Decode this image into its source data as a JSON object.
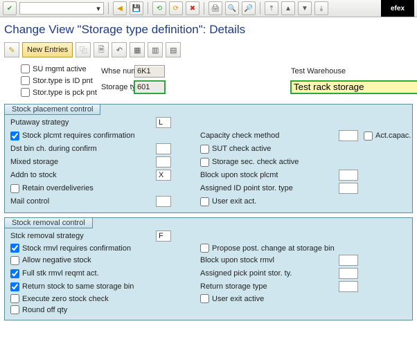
{
  "brand": "efex",
  "title": "Change View \"Storage type definition\": Details",
  "toolbar": {
    "combo_value": "",
    "new_entries": "New Entries"
  },
  "header": {
    "whse_label": "Whse number",
    "whse_value": "6K1",
    "whse_desc": "Test  Warehouse",
    "stype_label": "Storage type",
    "stype_value": "601",
    "stype_desc": "Test rack storage",
    "su_mgmt": "SU mgmt active",
    "id_pnt": "Stor.type is ID pnt",
    "pck_pnt": "Stor.type is pck pnt"
  },
  "placement": {
    "panel_title": "Stock placement control",
    "putaway_label": "Putaway strategy",
    "putaway_val": "L",
    "stock_plcmt_conf": "Stock plcmt requires confirmation",
    "dst_bin": "Dst bin ch. during confirm",
    "mixed": "Mixed storage",
    "addn_label": "Addn to stock",
    "addn_val": "X",
    "retain": "Retain overdeliveries",
    "mail": "Mail control",
    "cap_check": "Capacity check method",
    "act_capac": "Act.capac.",
    "sut_check": "SUT check active",
    "sec_check": "Storage sec. check active",
    "block_plcmt": "Block upon stock plcmt",
    "assigned_id": "Assigned ID point stor. type",
    "user_exit": "User exit act."
  },
  "removal": {
    "panel_title": "Stock removal control",
    "strategy_label": "Stck removal strategy",
    "strategy_val": "F",
    "rmvl_conf": "Stock rmvl requires confirmation",
    "allow_neg": "Allow negative stock",
    "full_stk": "Full stk rmvl reqmt act.",
    "return_same": "Return stock to same storage bin",
    "exec_zero": "Execute zero stock check",
    "round_off": "Round off qty",
    "propose": "Propose post. change at storage bin",
    "block_rmvl": "Block upon stock rmvl",
    "assigned_pick": "Assigned pick point stor. ty.",
    "return_type": "Return storage type",
    "user_exit": "User exit active"
  }
}
